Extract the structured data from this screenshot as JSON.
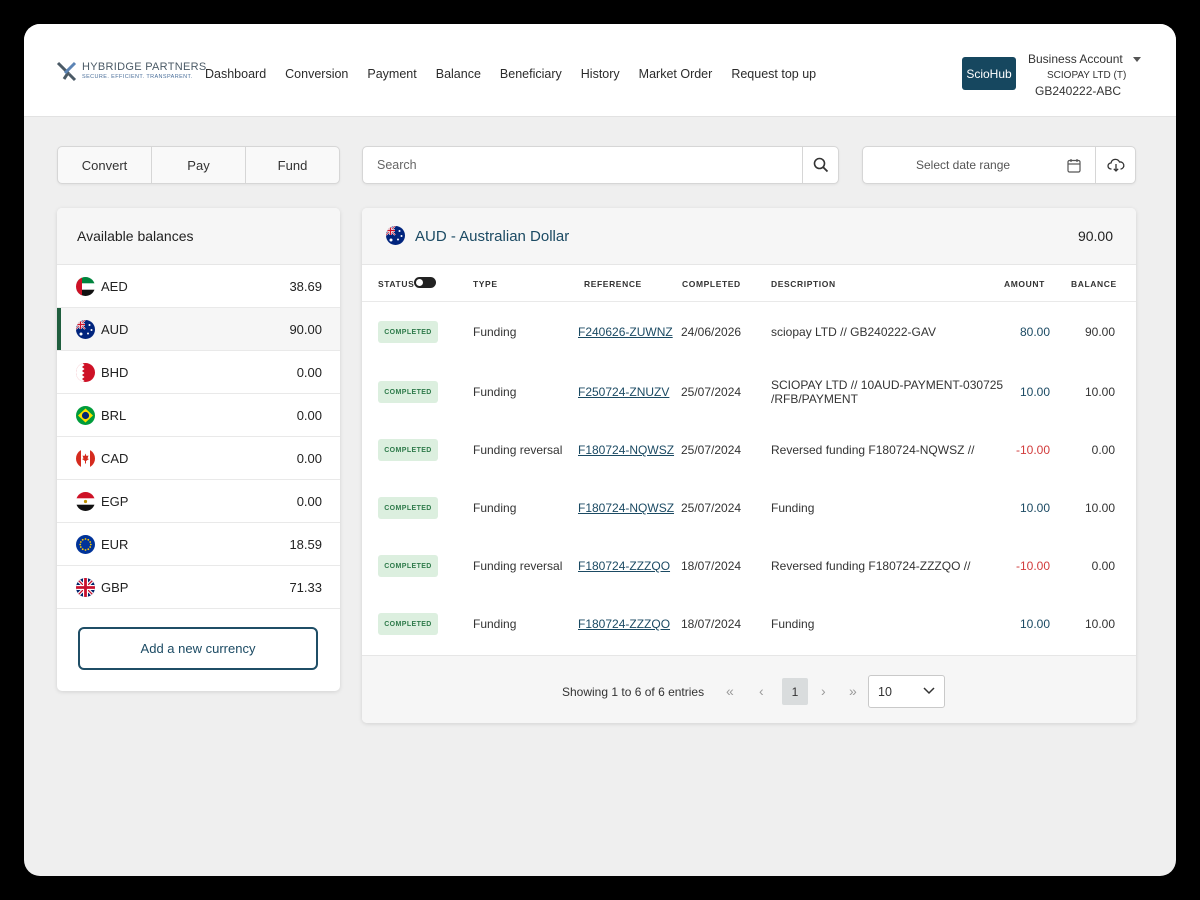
{
  "brand": {
    "name": "HYBRIDGE PARTNERS",
    "tagline": "SECURE. EFFICIENT. TRANSPARENT."
  },
  "nav": [
    "Dashboard",
    "Conversion",
    "Payment",
    "Balance",
    "Beneficiary",
    "History",
    "Market Order",
    "Request top up"
  ],
  "scio_label": "ScioHub",
  "account": {
    "title": "Business Account",
    "company": "SCIOPAY LTD (T)",
    "id": "GB240222-ABC"
  },
  "actions": [
    "Convert",
    "Pay",
    "Fund"
  ],
  "search": {
    "placeholder": "Search"
  },
  "date_range": {
    "placeholder": "Select date range"
  },
  "balances": {
    "title": "Available balances",
    "items": [
      {
        "code": "AED",
        "amount": "38.69"
      },
      {
        "code": "AUD",
        "amount": "90.00"
      },
      {
        "code": "BHD",
        "amount": "0.00"
      },
      {
        "code": "BRL",
        "amount": "0.00"
      },
      {
        "code": "CAD",
        "amount": "0.00"
      },
      {
        "code": "EGP",
        "amount": "0.00"
      },
      {
        "code": "EUR",
        "amount": "18.59"
      },
      {
        "code": "GBP",
        "amount": "71.33"
      }
    ],
    "add_label": "Add a new currency"
  },
  "selected": {
    "title": "AUD - Australian Dollar",
    "balance": "90.00"
  },
  "table": {
    "headers": [
      "STATUS",
      "TYPE",
      "REFERENCE",
      "COMPLETED",
      "DESCRIPTION",
      "AMOUNT",
      "BALANCE"
    ],
    "rows": [
      {
        "status": "COMPLETED",
        "type": "Funding",
        "reference": "F240626-ZUWNZ",
        "completed": "24/06/2026",
        "description": "sciopay LTD // GB240222-GAV",
        "description2": "",
        "amount": "80.00",
        "balance": "90.00"
      },
      {
        "status": "COMPLETED",
        "type": "Funding",
        "reference": "F250724-ZNUZV",
        "completed": "25/07/2024",
        "description": "SCIOPAY LTD // 10AUD-PAYMENT-030725",
        "description2": "/RFB/PAYMENT",
        "amount": "10.00",
        "balance": "10.00"
      },
      {
        "status": "COMPLETED",
        "type": "Funding reversal",
        "reference": "F180724-NQWSZ",
        "completed": "25/07/2024",
        "description": "Reversed funding F180724-NQWSZ //",
        "description2": "",
        "amount": "-10.00",
        "balance": "0.00"
      },
      {
        "status": "COMPLETED",
        "type": "Funding",
        "reference": "F180724-NQWSZ",
        "completed": "25/07/2024",
        "description": "Funding",
        "description2": "",
        "amount": "10.00",
        "balance": "10.00"
      },
      {
        "status": "COMPLETED",
        "type": "Funding reversal",
        "reference": "F180724-ZZZQO",
        "completed": "18/07/2024",
        "description": "Reversed funding F180724-ZZZQO //",
        "description2": "",
        "amount": "-10.00",
        "balance": "0.00"
      },
      {
        "status": "COMPLETED",
        "type": "Funding",
        "reference": "F180724-ZZZQO",
        "completed": "18/07/2024",
        "description": "Funding",
        "description2": "",
        "amount": "10.00",
        "balance": "10.00"
      }
    ]
  },
  "pagination": {
    "info": "Showing 1 to 6 of 6 entries",
    "page": "1",
    "page_size": "10"
  },
  "colors": {
    "primary": "#16475f",
    "positive": "#1b4a63",
    "negative": "#d23c3c",
    "badge_bg": "#dcefdf",
    "badge_text": "#2f7b4b",
    "active_marker": "#1f5e3e"
  }
}
